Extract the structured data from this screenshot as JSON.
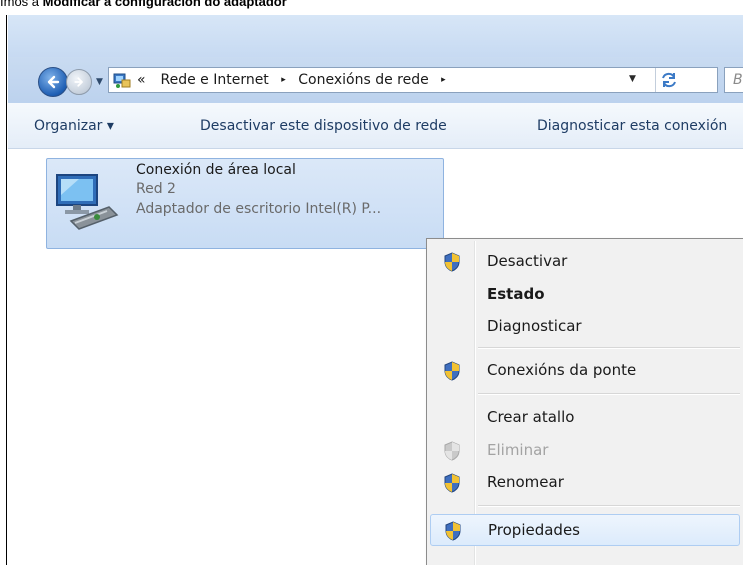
{
  "caption": {
    "prefix": "Imos a ",
    "bold": "Modificar a configuración do adaptador"
  },
  "address": {
    "chevrons": "«",
    "crumbs": [
      "Rede e Internet",
      "Conexións de rede"
    ],
    "separator": "▸",
    "search_placeholder": "B"
  },
  "toolbar": {
    "organize": "Organizar ▾",
    "disable": "Desactivar este dispositivo de rede",
    "diagnose": "Diagnosticar esta conexión"
  },
  "connection": {
    "name": "Conexión de área local",
    "network": "Red 2",
    "adapter": "Adaptador de escritorio Intel(R) P..."
  },
  "context_menu": {
    "items": [
      {
        "label": "Desactivar",
        "icon": "uac-shield-icon"
      },
      {
        "label": "Estado",
        "icon": ""
      },
      {
        "label": "Diagnosticar",
        "icon": ""
      },
      {
        "label": "Conexións da ponte",
        "icon": "uac-shield-icon"
      },
      {
        "label": "Crear atallo",
        "icon": ""
      },
      {
        "label": "Eliminar",
        "icon": "uac-shield-icon",
        "disabled": true
      },
      {
        "label": "Renomear",
        "icon": "uac-shield-icon"
      },
      {
        "label": "Propiedades",
        "icon": "uac-shield-icon",
        "highlighted": true
      }
    ]
  },
  "colors": {
    "window_chrome": "#c7daf2",
    "selection_tile": "#c8dcf4",
    "menu_background": "#f1f1f1",
    "toolbar_text": "#1e3c64"
  }
}
